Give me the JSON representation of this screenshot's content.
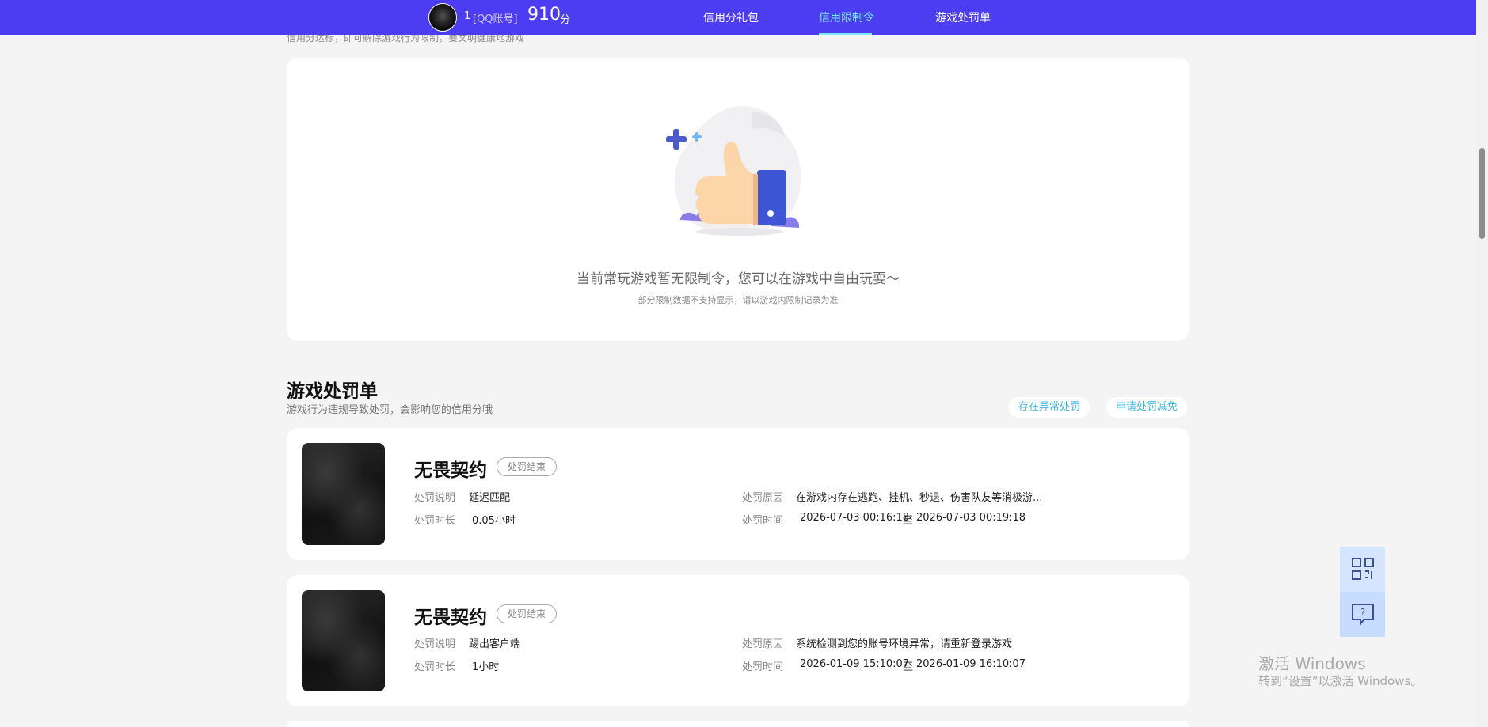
{
  "header": {
    "account_id": "1",
    "account_type": "[QQ账号]",
    "score": "910",
    "score_unit": "分",
    "nav": [
      {
        "label": "信用分礼包",
        "active": false
      },
      {
        "label": "信用限制令",
        "active": true
      },
      {
        "label": "游戏处罚单",
        "active": false
      }
    ]
  },
  "restriction": {
    "partial_subtitle": "信用分达标，即可解除游戏行为限制，要文明健康地游戏",
    "empty_text": "当前常玩游戏暂无限制令，您可以在游戏中自由玩耍～",
    "empty_note": "部分限制数据不支持显示，请以游戏内限制记录为准"
  },
  "penalty": {
    "title": "游戏处罚单",
    "subtitle": "游戏行为违规导致处罚，会影响您的信用分哦",
    "btn_abnormal": "存在异常处罚",
    "btn_reduce": "申请处罚减免",
    "labels": {
      "desc": "处罚说明",
      "duration": "处罚时长",
      "reason": "处罚原因",
      "time": "处罚时间",
      "to": "至"
    },
    "items": [
      {
        "game": "无畏契约",
        "status": "处罚结束",
        "desc": "延迟匹配",
        "duration": "0.05小时",
        "reason": "在游戏内存在逃跑、挂机、秒退、伤害队友等消极游...",
        "time_start": "2026-07-03 00:16:18",
        "time_end": "2026-07-03 00:19:18"
      },
      {
        "game": "无畏契约",
        "status": "处罚结束",
        "desc": "踢出客户端",
        "duration": "1小时",
        "reason": "系统检测到您的账号环境异常，请重新登录游戏",
        "time_start": "2026-01-09 15:10:07",
        "time_end": "2026-01-09 16:10:07"
      }
    ]
  },
  "watermark": {
    "line1": "激活 Windows",
    "line2": "转到“设置”以激活 Windows。"
  },
  "colors": {
    "header_bg": "#4c3df3",
    "accent": "#7de6ff",
    "link": "#3db7e8",
    "page_bg": "#f4f4f4"
  }
}
